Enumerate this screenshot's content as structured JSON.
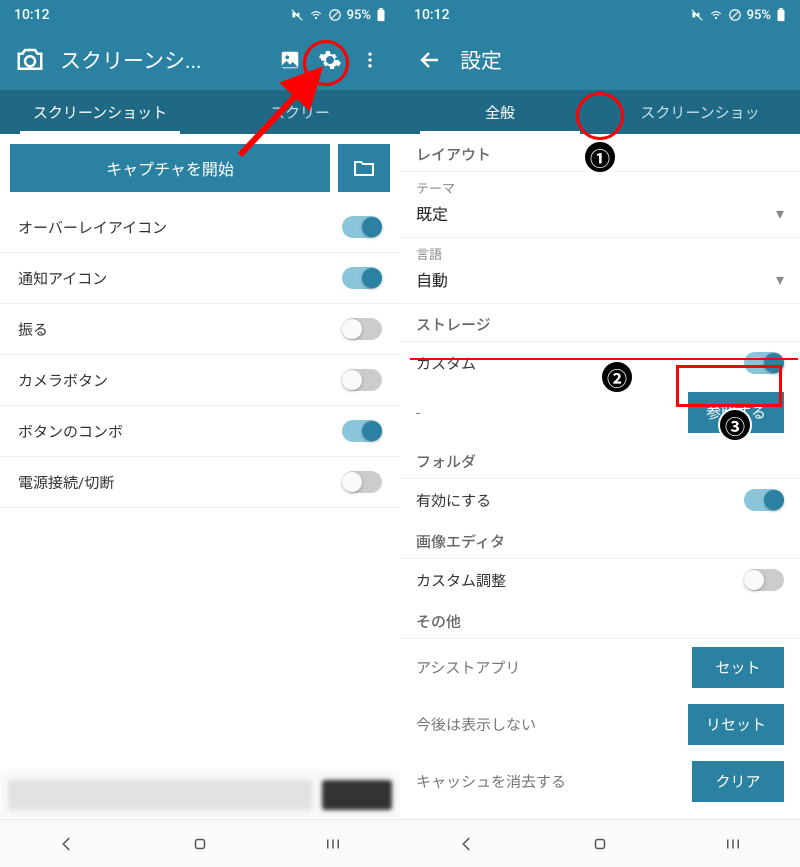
{
  "status": {
    "time": "10:12",
    "battery": "95%"
  },
  "left": {
    "app_title": "スクリーンシ...",
    "tabs": [
      "スクリーンショット",
      "スクリー"
    ],
    "capture_button": "キャプチャを開始",
    "items": [
      {
        "label": "オーバーレイアイコン",
        "on": true
      },
      {
        "label": "通知アイコン",
        "on": true
      },
      {
        "label": "振る",
        "on": false
      },
      {
        "label": "カメラボタン",
        "on": false
      },
      {
        "label": "ボタンのコンボ",
        "on": true
      },
      {
        "label": "電源接続/切断",
        "on": false
      }
    ]
  },
  "right": {
    "title": "設定",
    "tabs": [
      "全般",
      "スクリーンショッ"
    ],
    "sections": {
      "layout": {
        "header": "レイアウト",
        "theme_label": "テーマ",
        "theme_value": "既定",
        "lang_label": "言語",
        "lang_value": "自動"
      },
      "storage": {
        "header": "ストレージ",
        "custom_label": "カスタム",
        "custom_on": true,
        "path": "-",
        "browse": "参照する"
      },
      "folder": {
        "header": "フォルダ",
        "enable_label": "有効にする",
        "enable_on": true
      },
      "editor": {
        "header": "画像エディタ",
        "custom_adjust_label": "カスタム調整",
        "custom_adjust_on": false
      },
      "other": {
        "header": "その他",
        "assist_label": "アシストアプリ",
        "assist_btn": "セット",
        "noshow_label": "今後は表示しない",
        "noshow_btn": "リセット",
        "cache_label": "キャッシュを消去する",
        "cache_btn": "クリア"
      }
    }
  },
  "annotations": {
    "badge1": "①",
    "badge2": "②",
    "badge3": "③"
  }
}
